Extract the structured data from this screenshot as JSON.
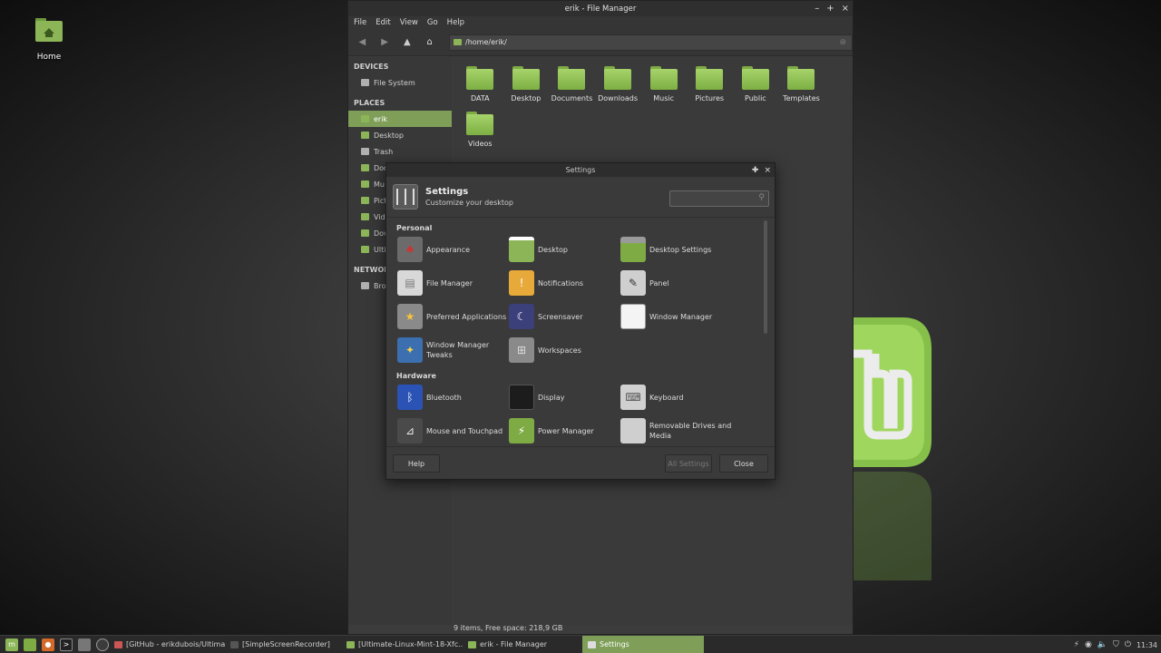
{
  "desktop": {
    "home_label": "Home"
  },
  "file_manager": {
    "title": "erik - File Manager",
    "menu": [
      "File",
      "Edit",
      "View",
      "Go",
      "Help"
    ],
    "location": "/home/erik/",
    "sidebar": {
      "devices_header": "DEVICES",
      "devices": [
        {
          "label": "File System"
        }
      ],
      "places_header": "PLACES",
      "places": [
        {
          "label": "erik"
        },
        {
          "label": "Desktop"
        },
        {
          "label": "Trash"
        },
        {
          "label": "Doc"
        },
        {
          "label": "Mu"
        },
        {
          "label": "Pict"
        },
        {
          "label": "Vide"
        },
        {
          "label": "Dov"
        },
        {
          "label": "Ulti"
        }
      ],
      "network_header": "NETWOR",
      "network": [
        {
          "label": "Bro"
        }
      ]
    },
    "folders": [
      "DATA",
      "Desktop",
      "Documents",
      "Downloads",
      "Music",
      "Pictures",
      "Public",
      "Templates",
      "Videos"
    ],
    "status": "9 items, Free space: 218,9 GB"
  },
  "settings": {
    "window_title": "Settings",
    "header_title": "Settings",
    "header_subtitle": "Customize your desktop",
    "search_placeholder": "",
    "sections": {
      "personal": "Personal",
      "hardware": "Hardware"
    },
    "personal_items": [
      {
        "label": "Appearance",
        "icon": "appearance-icon"
      },
      {
        "label": "Desktop",
        "icon": "desktop-icon"
      },
      {
        "label": "Desktop Settings",
        "icon": "desktop-settings-icon"
      },
      {
        "label": "File Manager",
        "icon": "file-manager-icon"
      },
      {
        "label": "Notifications",
        "icon": "notifications-icon"
      },
      {
        "label": "Panel",
        "icon": "panel-icon"
      },
      {
        "label": "Preferred Applications",
        "icon": "preferred-apps-icon"
      },
      {
        "label": "Screensaver",
        "icon": "screensaver-icon"
      },
      {
        "label": "Window Manager",
        "icon": "window-manager-icon"
      },
      {
        "label": "Window Manager Tweaks",
        "icon": "wm-tweaks-icon"
      },
      {
        "label": "Workspaces",
        "icon": "workspaces-icon"
      }
    ],
    "hardware_items": [
      {
        "label": "Bluetooth",
        "icon": "bluetooth-icon"
      },
      {
        "label": "Display",
        "icon": "display-icon"
      },
      {
        "label": "Keyboard",
        "icon": "keyboard-icon"
      },
      {
        "label": "Mouse and Touchpad",
        "icon": "mouse-icon"
      },
      {
        "label": "Power Manager",
        "icon": "power-icon"
      },
      {
        "label": "Removable Drives and Media",
        "icon": "removable-drives-icon"
      }
    ],
    "buttons": {
      "help": "Help",
      "all_settings": "All Settings",
      "close": "Close"
    }
  },
  "taskbar": {
    "tasks": [
      {
        "label": "[GitHub - erikdubois/Ultimat..."
      },
      {
        "label": "[SimpleScreenRecorder]"
      },
      {
        "label": "[Ultimate-Linux-Mint-18-Xfc..."
      },
      {
        "label": "erik - File Manager"
      },
      {
        "label": "Settings"
      }
    ],
    "clock": "11:34"
  },
  "colors": {
    "accent": "#7f9e58",
    "folder_green": "#8cb558"
  }
}
